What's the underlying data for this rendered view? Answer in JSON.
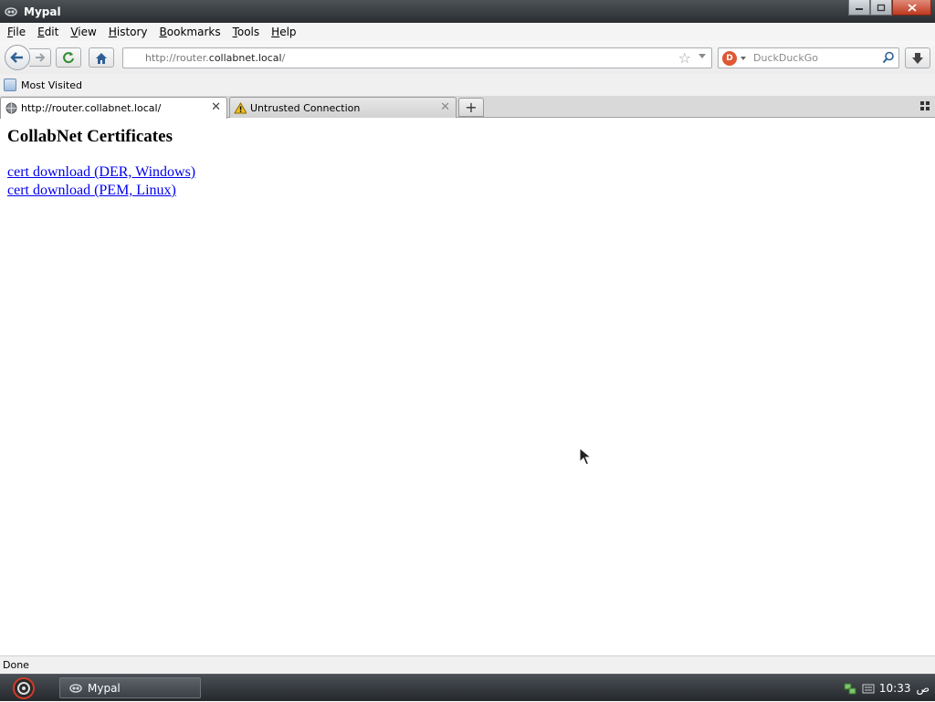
{
  "window": {
    "title": "Mypal"
  },
  "menu": {
    "items": [
      {
        "label": "File",
        "key": "F",
        "rest": "ile"
      },
      {
        "label": "Edit",
        "key": "E",
        "rest": "dit"
      },
      {
        "label": "View",
        "key": "V",
        "rest": "iew"
      },
      {
        "label": "History",
        "key": "H",
        "rest": "istory"
      },
      {
        "label": "Bookmarks",
        "key": "B",
        "rest": "ookmarks"
      },
      {
        "label": "Tools",
        "key": "T",
        "rest": "ools"
      },
      {
        "label": "Help",
        "key": "H",
        "rest": "elp"
      }
    ]
  },
  "navbar": {
    "url_prefix": "http://router.",
    "url_domain": "collabnet.local",
    "url_suffix": "/",
    "search_placeholder": "DuckDuckGo",
    "search_engine_badge": "D"
  },
  "bookmarks": {
    "most_visited": "Most Visited"
  },
  "tabs": [
    {
      "label": "http://router.collabnet.local/",
      "icon": "globe-icon",
      "active": true
    },
    {
      "label": "Untrusted Connection",
      "icon": "warning-icon",
      "active": false
    }
  ],
  "page": {
    "heading": "CollabNet Certificates",
    "links": [
      "cert download (DER, Windows)",
      "cert download (PEM, Linux)"
    ]
  },
  "status": {
    "text": "Done"
  },
  "taskbar": {
    "task_label": "Mypal",
    "clock": "10:33",
    "ampm": "ص"
  },
  "colors": {
    "link": "#0000ee",
    "title_bar": "#2a2e32"
  }
}
